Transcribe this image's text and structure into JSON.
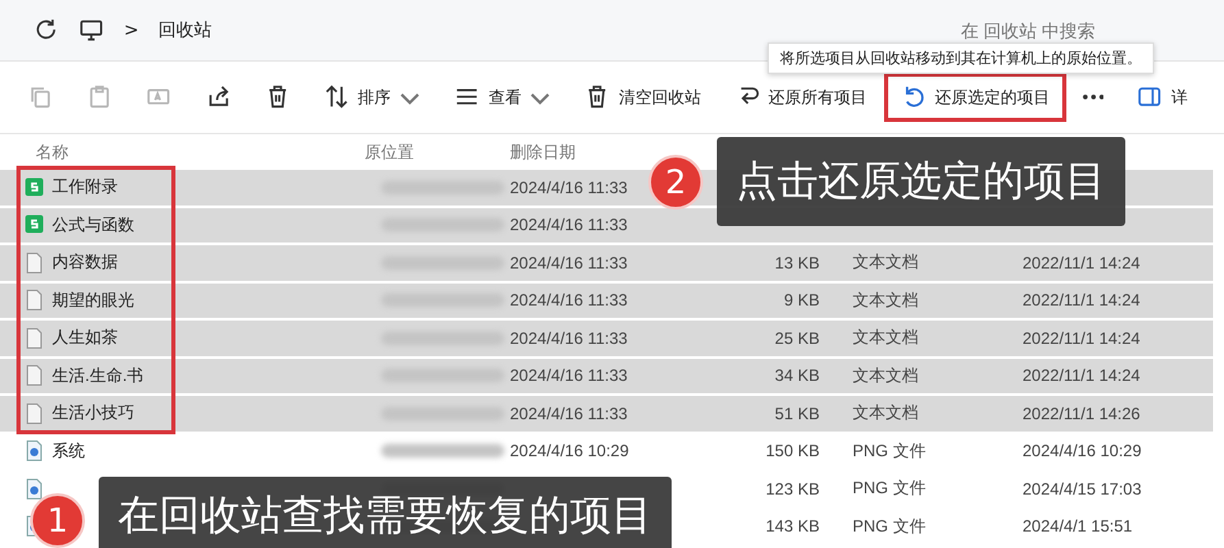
{
  "address_bar": {
    "separator": ">",
    "location": "回收站",
    "search_placeholder": "在 回收站 中搜索"
  },
  "tooltip": "将所选项目从回收站移动到其在计算机上的原始位置。",
  "toolbar": [
    {
      "kind": "icon",
      "disabled": true
    },
    {
      "kind": "icon",
      "disabled": true
    },
    {
      "kind": "icon",
      "disabled": true
    },
    {
      "kind": "icon",
      "disabled": false
    },
    {
      "kind": "icon",
      "disabled": false
    },
    {
      "kind": "menu",
      "label": "排序"
    },
    {
      "kind": "menu",
      "label": "查看"
    },
    {
      "kind": "button",
      "label": "清空回收站",
      "highlighted": false
    },
    {
      "kind": "button",
      "label": "还原所有项目",
      "highlighted": false
    },
    {
      "kind": "button",
      "label": "还原选定的项目",
      "highlighted": true
    },
    {
      "kind": "icon",
      "disabled": false
    },
    {
      "kind": "button",
      "label": "详",
      "highlighted": false
    }
  ],
  "table": {
    "columns": [
      "名称",
      "原位置",
      "删除日期"
    ],
    "rows": [
      {
        "selected": true,
        "kind": "sheet",
        "name": "工作附录",
        "deleted": "2024/4/16 11:33"
      },
      {
        "selected": true,
        "kind": "sheet",
        "name": "公式与函数",
        "deleted": "2024/4/16 11:33"
      },
      {
        "selected": true,
        "kind": "text",
        "name": "内容数据",
        "deleted": "2024/4/16 11:33",
        "size": "13 KB",
        "type": "文本文档",
        "modified": "2022/11/1 14:24"
      },
      {
        "selected": true,
        "kind": "text",
        "name": "期望的眼光",
        "deleted": "2024/4/16 11:33",
        "size": "9 KB",
        "type": "文本文档",
        "modified": "2022/11/1 14:24"
      },
      {
        "selected": true,
        "kind": "text",
        "name": "人生如茶",
        "deleted": "2024/4/16 11:33",
        "size": "25 KB",
        "type": "文本文档",
        "modified": "2022/11/1 14:24"
      },
      {
        "selected": true,
        "kind": "text",
        "name": "生活.生命.书",
        "deleted": "2024/4/16 11:33",
        "size": "34 KB",
        "type": "文本文档",
        "modified": "2022/11/1 14:24"
      },
      {
        "selected": true,
        "kind": "text",
        "name": "生活小技巧",
        "deleted": "2024/4/16 11:33",
        "size": "51 KB",
        "type": "文本文档",
        "modified": "2022/11/1 14:26"
      },
      {
        "selected": false,
        "kind": "image",
        "name": "系统",
        "deleted": "2024/4/16 10:29",
        "size": "150 KB",
        "type": "PNG 文件",
        "modified": "2024/4/16 10:29"
      },
      {
        "selected": false,
        "kind": "image",
        "size": "123 KB",
        "type": "PNG 文件",
        "modified": "2024/4/15 17:03"
      },
      {
        "selected": false,
        "kind": "image",
        "size": "143 KB",
        "type": "PNG 文件",
        "modified": "2024/4/1 15:51"
      }
    ]
  },
  "callouts": [
    {
      "number": "2",
      "text": "点击还原选定的项目"
    },
    {
      "number": "1",
      "text": "在回收站查找需要恢复的项目"
    }
  ]
}
